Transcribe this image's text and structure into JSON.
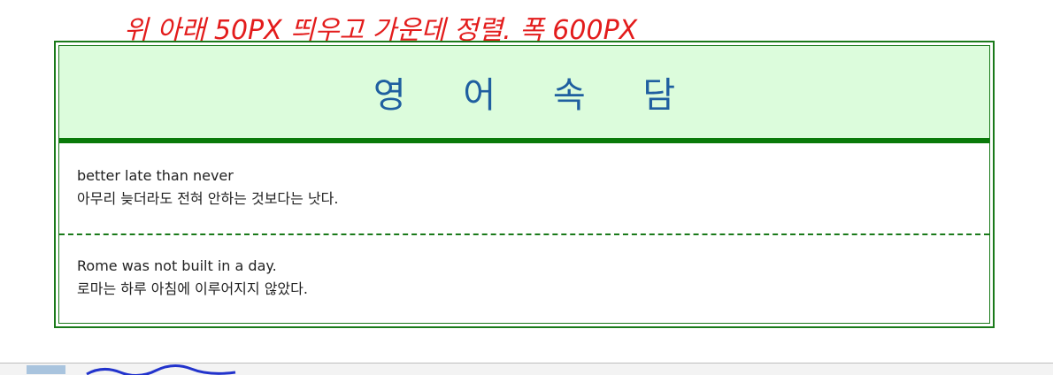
{
  "annotation": {
    "handwritten_note": "위 아래 50PX 띄우고 가운데 정렬. 폭 600PX",
    "color": "#e31c1c"
  },
  "card": {
    "title": "영 어 속 담",
    "title_color": "#1f5fa0",
    "header_bg": "#dcfcdc",
    "border_color": "#1a7a1a",
    "proverbs": [
      {
        "english": "better late than never",
        "korean": "아무리 늦더라도 전혀 안하는 것보다는 낫다."
      },
      {
        "english": "Rome was not built in a day.",
        "korean": "로마는 하루 아침에 이루어지지 않았다."
      }
    ]
  }
}
